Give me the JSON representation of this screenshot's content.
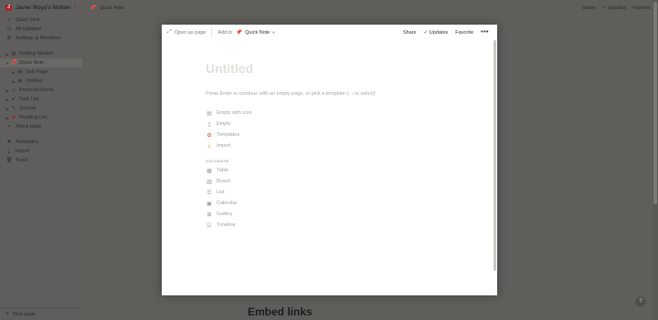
{
  "sidebar": {
    "workspace": "Javier Moya's Notion",
    "workspace_initial": "J",
    "top_items": [
      {
        "label": "Quick Find",
        "icon": "search-icon"
      },
      {
        "label": "All Updates",
        "icon": "clock-icon"
      },
      {
        "label": "Settings & Members",
        "icon": "gear-icon"
      }
    ],
    "pages": [
      {
        "label": "Getting Started",
        "icon": "document-icon"
      },
      {
        "label": "Quick Note",
        "icon": "pushpin-icon"
      },
      {
        "label": "Sub Page",
        "icon": "document-icon"
      },
      {
        "label": "Untitled",
        "icon": "document-icon"
      },
      {
        "label": "Personal Home",
        "icon": "house-icon"
      },
      {
        "label": "Task List",
        "icon": "checkmark-icon"
      },
      {
        "label": "Journal",
        "icon": "pencil-icon"
      },
      {
        "label": "Reading List",
        "icon": "book-icon"
      }
    ],
    "add_page": "Add a page",
    "bottom_items": [
      {
        "label": "Templates",
        "icon": "templates-icon"
      },
      {
        "label": "Import",
        "icon": "import-icon"
      },
      {
        "label": "Trash",
        "icon": "trash-icon"
      }
    ],
    "new_page": "New page"
  },
  "topbar": {
    "breadcrumb": "Quick Note",
    "share": "Share",
    "updates": "Updates",
    "favorite": "Favorite"
  },
  "background": {
    "heading": "Embed links",
    "help": "?"
  },
  "modal": {
    "open_as_page": "Open as page",
    "add_to": "Add to",
    "target": "Quick Note",
    "share": "Share",
    "updates": "Updates",
    "favorite": "Favorite",
    "more": "•••",
    "title_placeholder": "Untitled",
    "hint": "Press Enter to continue with an empty page, or pick a template (↑↓ to select)",
    "options": [
      {
        "label": "Empty with icon",
        "icon": "document-icon"
      },
      {
        "label": "Empty",
        "icon": "blank-page-icon"
      },
      {
        "label": "Templates",
        "icon": "palette-icon"
      },
      {
        "label": "Import",
        "icon": "import-icon"
      }
    ],
    "database_header": "DATABASE",
    "databases": [
      {
        "label": "Table",
        "icon": "table-icon"
      },
      {
        "label": "Board",
        "icon": "board-icon"
      },
      {
        "label": "List",
        "icon": "list-icon"
      },
      {
        "label": "Calendar",
        "icon": "calendar-icon"
      },
      {
        "label": "Gallery",
        "icon": "gallery-icon"
      },
      {
        "label": "Timeline",
        "icon": "timeline-icon"
      }
    ]
  }
}
